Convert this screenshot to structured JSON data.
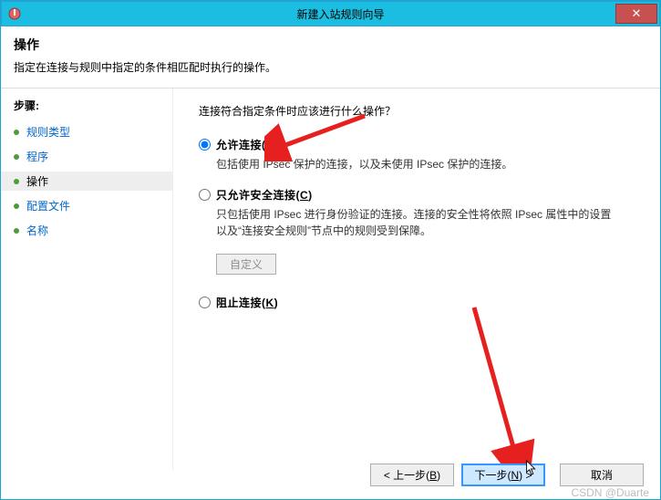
{
  "titlebar": {
    "title": "新建入站规则向导",
    "close": "✕"
  },
  "header": {
    "title": "操作",
    "desc": "指定在连接与规则中指定的条件相匹配时执行的操作。"
  },
  "sidebar": {
    "title": "步骤:",
    "items": [
      {
        "label": "规则类型"
      },
      {
        "label": "程序"
      },
      {
        "label": "操作"
      },
      {
        "label": "配置文件"
      },
      {
        "label": "名称"
      }
    ]
  },
  "main": {
    "question": "连接符合指定条件时应该进行什么操作？",
    "options": [
      {
        "key": "allow",
        "label_pre": "允许连接(",
        "hotkey": "A",
        "label_post": ")",
        "desc": "包括使用 IPsec 保护的连接，以及未使用 IPsec 保护的连接。"
      },
      {
        "key": "secure",
        "label_pre": "只允许安全连接(",
        "hotkey": "C",
        "label_post": ")",
        "desc": "只包括使用 IPsec 进行身份验证的连接。连接的安全性将依照 IPsec 属性中的设置以及“连接安全规则”节点中的规则受到保障。"
      },
      {
        "key": "block",
        "label_pre": "阻止连接(",
        "hotkey": "K",
        "label_post": ")",
        "desc": ""
      }
    ],
    "custom_btn": "自定义",
    "selected": "allow"
  },
  "buttons": {
    "back_pre": "< 上一步(",
    "back_hot": "B",
    "back_post": ")",
    "next_pre": "下一步(",
    "next_hot": "N",
    "next_post": ") >",
    "cancel": "取消"
  },
  "watermark": "CSDN @Duarte"
}
